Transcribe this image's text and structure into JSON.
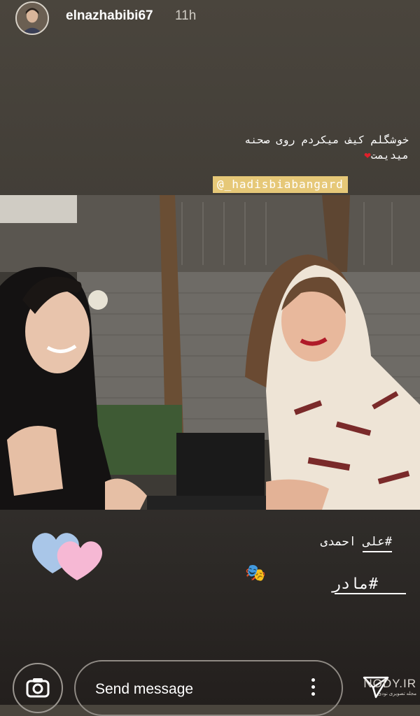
{
  "story": {
    "username": "elnazhabibi67",
    "time": "11h",
    "caption_line1": "خوشگلم کیف میکردم روی صحنه",
    "caption_line2": "میدیمت",
    "mention": "@_hadisbiabangard",
    "hashtag1": "#علی احمدی",
    "hashtag2": "#مادر",
    "sticker_hearts": "hearts-sticker-icon",
    "sticker_masks": "theater-masks-icon"
  },
  "footer": {
    "send_placeholder": "Send message",
    "camera_icon": "camera-icon",
    "more_icon": "more-dots-icon",
    "share_icon": "direct-share-icon"
  },
  "watermark": {
    "brand": "NODY.IR",
    "subtitle": "مجله تصویری نودی"
  }
}
